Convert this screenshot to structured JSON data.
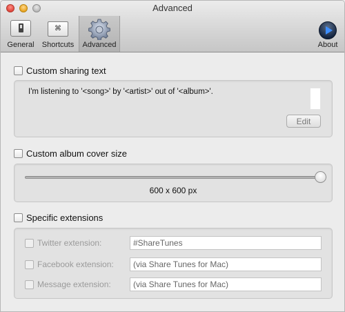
{
  "window": {
    "title": "Advanced"
  },
  "toolbar": {
    "items": [
      {
        "label": "General",
        "icon": "switch-icon"
      },
      {
        "label": "Shortcuts",
        "icon": "command-key-icon",
        "glyph": "⌘"
      },
      {
        "label": "Advanced",
        "icon": "gear-icon",
        "active": true
      },
      {
        "label": "About",
        "icon": "play-icon"
      }
    ]
  },
  "sharing": {
    "checkbox_label": "Custom sharing text",
    "checked": false,
    "text": "I'm listening to '<song>' by '<artist>' out of '<album>'.",
    "edit_label": "Edit"
  },
  "cover": {
    "checkbox_label": "Custom album cover size",
    "checked": false,
    "slider_value": 1.0,
    "size_label": "600 x 600 px"
  },
  "extensions": {
    "checkbox_label": "Specific extensions",
    "checked": false,
    "items": [
      {
        "label": "Twitter extension:",
        "value": "#ShareTunes"
      },
      {
        "label": "Facebook extension:",
        "value": "(via Share Tunes for Mac)"
      },
      {
        "label": "Message extension:",
        "value": "(via Share Tunes for Mac)"
      }
    ]
  },
  "colors": {
    "window_bg": "#ececec",
    "group_bg": "#e2e2e2",
    "disabled_text": "#9a9a9a",
    "about_icon_accent": "#3d8eff"
  }
}
